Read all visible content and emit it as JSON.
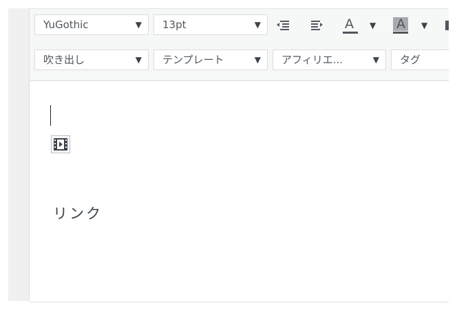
{
  "toolbar": {
    "font_family": "YuGothic",
    "font_size": "13pt",
    "format_fuki": "吹き出し",
    "template": "テンプレート",
    "affiliate": "アフィリエ...",
    "tag": "タグ",
    "dropdown_arrow": "▼",
    "text_color_letter": "A",
    "bg_color_letter": "A",
    "text_color_bar": "#50575e",
    "bg_color_bar": "#50575e"
  },
  "content": {
    "link_text": "リンク"
  }
}
